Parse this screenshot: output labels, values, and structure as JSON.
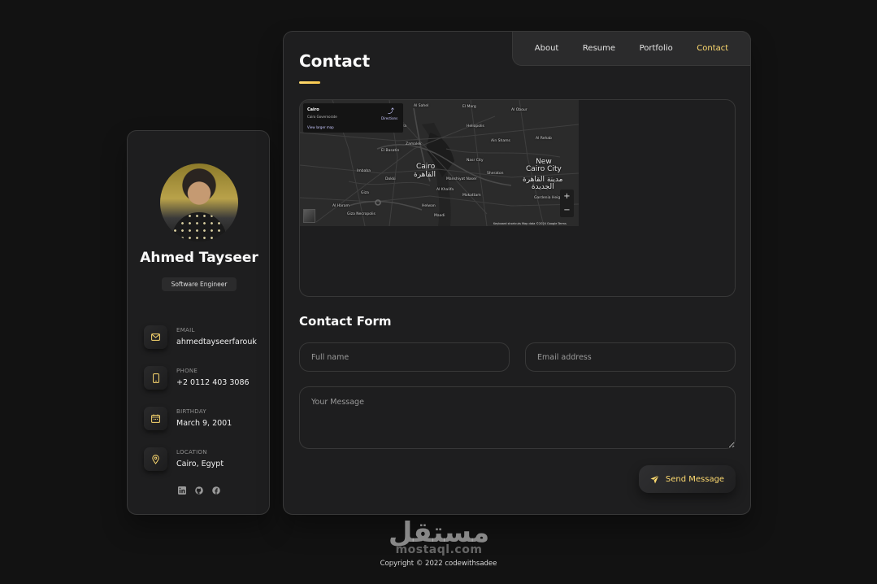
{
  "sidebar": {
    "name": "Ahmed Tayseer",
    "title": "Software Engineer",
    "contacts": [
      {
        "label": "EMAIL",
        "value": "ahmedtayseerfarouk",
        "icon": "mail-icon"
      },
      {
        "label": "PHONE",
        "value": "+2 0112 403 3086",
        "icon": "phone-icon"
      },
      {
        "label": "BIRTHDAY",
        "value": "March 9, 2001",
        "icon": "calendar-icon"
      },
      {
        "label": "LOCATION",
        "value": "Cairo, Egypt",
        "icon": "location-pin-icon"
      }
    ],
    "socials": [
      "linkedin-icon",
      "github-icon",
      "facebook-icon"
    ]
  },
  "nav": {
    "items": [
      {
        "label": "About"
      },
      {
        "label": "Resume"
      },
      {
        "label": "Portfolio"
      },
      {
        "label": "Contact"
      }
    ],
    "active": "Contact"
  },
  "page": {
    "title": "Contact"
  },
  "map": {
    "info_city": "Cairo",
    "info_gov": "Cairo Governorate",
    "info_link": "View larger map",
    "directions": "Directions",
    "city_label": "Cairo",
    "city_label_ar": "القاهرة",
    "new_city_label": "New\nCairo City",
    "new_city_label_ar": "مدينة القاهرة\nالجديدة",
    "zoom_in": "+",
    "zoom_out": "−",
    "footer": "Keyboard shortcuts   Map data ©2024 Google   Terms",
    "small_labels": [
      "El Basatin",
      "Al Sahel",
      "Giza",
      "Al Khalifa",
      "Nasr City",
      "Heliopolis",
      "Al Obour",
      "El Marg",
      "Shubra",
      "Imbaba",
      "Dokki",
      "Maadi",
      "Ain Shams",
      "Zamalek",
      "Helwan",
      "Manshiyat Naser",
      "Sheraton",
      "Gardenia Heights",
      "Mokattam",
      "Al Rehab",
      "Giza Necropolis",
      "Al Haram"
    ]
  },
  "form": {
    "title": "Contact Form",
    "fullname_placeholder": "Full name",
    "email_placeholder": "Email address",
    "message_placeholder": "Your Message",
    "send_label": "Send Message"
  },
  "footer": {
    "copyright": "Copyright © 2022 codewithsadee"
  },
  "watermark": {
    "arabic": "مستقل",
    "latin": "mostaql.com"
  },
  "colors": {
    "accent": "#ffdb70",
    "background": "#121212",
    "card": "#1e1e1f",
    "border": "#383838"
  }
}
